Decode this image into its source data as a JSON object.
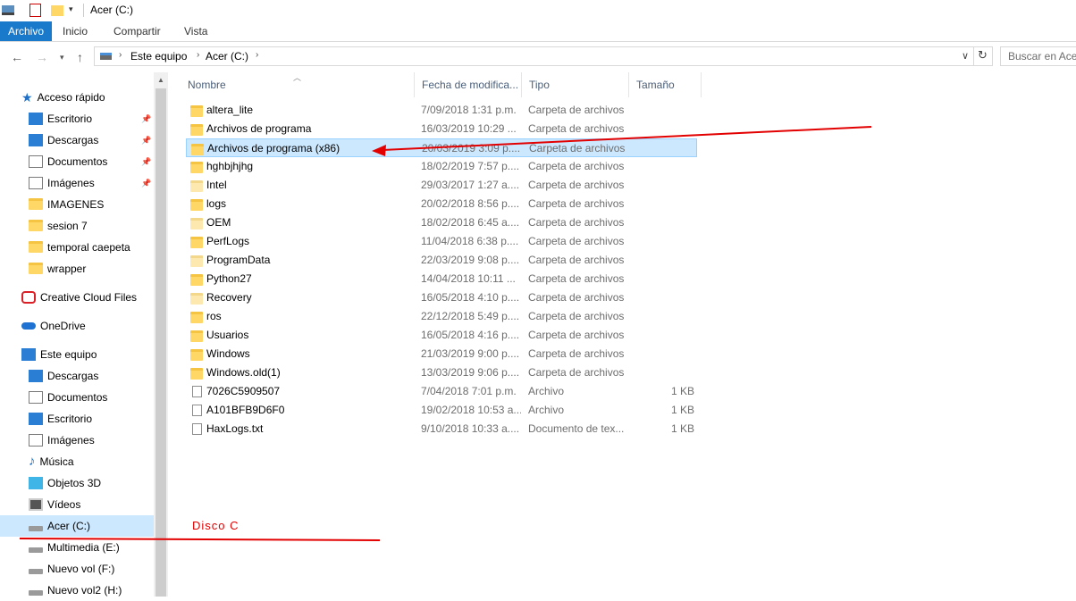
{
  "window": {
    "title": "Acer (C:)"
  },
  "ribbon": {
    "tabs": [
      "Archivo",
      "Inicio",
      "Compartir",
      "Vista"
    ]
  },
  "address": {
    "crumbs": [
      "Este equipo",
      "Acer (C:)"
    ],
    "search_placeholder": "Buscar en Acer"
  },
  "sidebar": {
    "items": [
      {
        "label": "Acceso rápido",
        "icon": "star-icon"
      },
      {
        "label": "Escritorio",
        "icon": "desktop-icon",
        "pinned": true
      },
      {
        "label": "Descargas",
        "icon": "download-icon",
        "pinned": true
      },
      {
        "label": "Documentos",
        "icon": "documents-icon",
        "pinned": true
      },
      {
        "label": "Imágenes",
        "icon": "pictures-icon",
        "pinned": true
      },
      {
        "label": "IMAGENES",
        "icon": "folder-icon"
      },
      {
        "label": "sesion 7",
        "icon": "folder-icon"
      },
      {
        "label": "temporal caepeta",
        "icon": "folder-icon"
      },
      {
        "label": "wrapper",
        "icon": "folder-icon"
      },
      {
        "label": "Creative Cloud Files",
        "icon": "creative-cloud-icon"
      },
      {
        "label": "OneDrive",
        "icon": "onedrive-icon"
      },
      {
        "label": "Este equipo",
        "icon": "computer-icon"
      },
      {
        "label": "Descargas",
        "icon": "download-icon"
      },
      {
        "label": "Documentos",
        "icon": "documents-icon"
      },
      {
        "label": "Escritorio",
        "icon": "desktop-icon"
      },
      {
        "label": "Imágenes",
        "icon": "pictures-icon"
      },
      {
        "label": "Música",
        "icon": "music-icon"
      },
      {
        "label": "Objetos 3D",
        "icon": "3d-objects-icon"
      },
      {
        "label": "Vídeos",
        "icon": "videos-icon"
      },
      {
        "label": "Acer (C:)",
        "icon": "drive-icon",
        "selected": true
      },
      {
        "label": "Multimedia (E:)",
        "icon": "drive-icon"
      },
      {
        "label": "Nuevo vol (F:)",
        "icon": "drive-icon"
      },
      {
        "label": "Nuevo vol2 (H:)",
        "icon": "drive-icon"
      }
    ]
  },
  "columns": {
    "name": "Nombre",
    "date": "Fecha de modifica...",
    "type": "Tipo",
    "size": "Tamaño"
  },
  "files": [
    {
      "name": "altera_lite",
      "date": "7/09/2018 1:31 p.m.",
      "type": "Carpeta de archivos",
      "size": "",
      "kind": "folder"
    },
    {
      "name": "Archivos de programa",
      "date": "16/03/2019 10:29 ...",
      "type": "Carpeta de archivos",
      "size": "",
      "kind": "folder"
    },
    {
      "name": "Archivos de programa (x86)",
      "date": "20/03/2019 3:09 p....",
      "type": "Carpeta de archivos",
      "size": "",
      "kind": "folder",
      "selected": true
    },
    {
      "name": "hghbjhjhg",
      "date": "18/02/2019 7:57 p....",
      "type": "Carpeta de archivos",
      "size": "",
      "kind": "folder"
    },
    {
      "name": "Intel",
      "date": "29/03/2017 1:27 a....",
      "type": "Carpeta de archivos",
      "size": "",
      "kind": "folder-light"
    },
    {
      "name": "logs",
      "date": "20/02/2018 8:56 p....",
      "type": "Carpeta de archivos",
      "size": "",
      "kind": "folder"
    },
    {
      "name": "OEM",
      "date": "18/02/2018 6:45 a....",
      "type": "Carpeta de archivos",
      "size": "",
      "kind": "folder-light"
    },
    {
      "name": "PerfLogs",
      "date": "11/04/2018 6:38 p....",
      "type": "Carpeta de archivos",
      "size": "",
      "kind": "folder"
    },
    {
      "name": "ProgramData",
      "date": "22/03/2019 9:08 p....",
      "type": "Carpeta de archivos",
      "size": "",
      "kind": "folder-light"
    },
    {
      "name": "Python27",
      "date": "14/04/2018 10:11 ...",
      "type": "Carpeta de archivos",
      "size": "",
      "kind": "folder"
    },
    {
      "name": "Recovery",
      "date": "16/05/2018 4:10 p....",
      "type": "Carpeta de archivos",
      "size": "",
      "kind": "folder-light"
    },
    {
      "name": "ros",
      "date": "22/12/2018 5:49 p....",
      "type": "Carpeta de archivos",
      "size": "",
      "kind": "folder"
    },
    {
      "name": "Usuarios",
      "date": "16/05/2018 4:16 p....",
      "type": "Carpeta de archivos",
      "size": "",
      "kind": "folder"
    },
    {
      "name": "Windows",
      "date": "21/03/2019 9:00 p....",
      "type": "Carpeta de archivos",
      "size": "",
      "kind": "folder"
    },
    {
      "name": "Windows.old(1)",
      "date": "13/03/2019 9:06 p....",
      "type": "Carpeta de archivos",
      "size": "",
      "kind": "folder"
    },
    {
      "name": "7026C5909507",
      "date": "7/04/2018 7:01 p.m.",
      "type": "Archivo",
      "size": "1 KB",
      "kind": "file"
    },
    {
      "name": "A101BFB9D6F0",
      "date": "19/02/2018 10:53 a....",
      "type": "Archivo",
      "size": "1 KB",
      "kind": "file"
    },
    {
      "name": "HaxLogs.txt",
      "date": "9/10/2018 10:33 a....",
      "type": "Documento de tex...",
      "size": "1 KB",
      "kind": "text-file"
    }
  ],
  "annotation": {
    "label": "Disco C",
    "color": "#e30000"
  }
}
